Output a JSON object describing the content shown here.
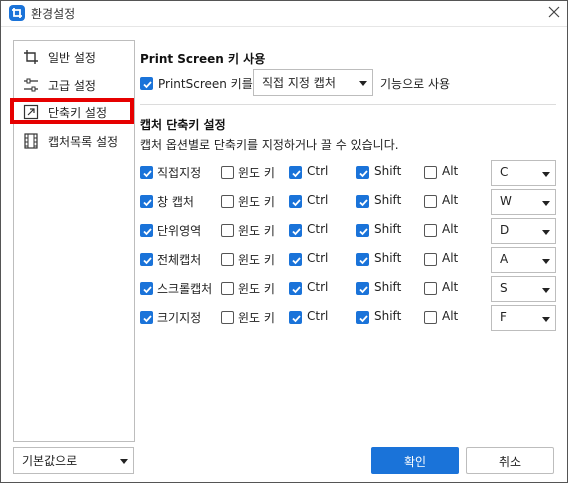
{
  "window": {
    "title": "환경설정"
  },
  "sidebar": {
    "items": [
      {
        "label": "일반 설정",
        "icon": "crop-icon"
      },
      {
        "label": "고급 설정",
        "icon": "sliders-icon"
      },
      {
        "label": "단축키 설정",
        "icon": "shortcut-icon"
      },
      {
        "label": "캡처목록 설정",
        "icon": "filmstrip-icon"
      }
    ],
    "selected": "단축키 설정"
  },
  "print_screen": {
    "section_title": "Print Screen 키 사용",
    "checkbox_label": "PrintScreen 키를",
    "checked": true,
    "select_value": "직접 지정 캡처",
    "suffix": "기능으로 사용"
  },
  "shortcut": {
    "section_title": "캡처 단축키 설정",
    "description": "캡처 옵션별로 단축키를 지정하거나 끌 수 있습니다.",
    "modifier_labels": {
      "win": "윈도 키",
      "ctrl": "Ctrl",
      "shift": "Shift",
      "alt": "Alt"
    },
    "rows": [
      {
        "name": "직접지정",
        "enabled": true,
        "win": false,
        "ctrl": true,
        "shift": true,
        "alt": false,
        "key": "C"
      },
      {
        "name": "창 캡처",
        "enabled": true,
        "win": false,
        "ctrl": true,
        "shift": true,
        "alt": false,
        "key": "W"
      },
      {
        "name": "단위영역",
        "enabled": true,
        "win": false,
        "ctrl": true,
        "shift": true,
        "alt": false,
        "key": "D"
      },
      {
        "name": "전체캡처",
        "enabled": true,
        "win": false,
        "ctrl": true,
        "shift": true,
        "alt": false,
        "key": "A"
      },
      {
        "name": "스크롤캡처",
        "enabled": true,
        "win": false,
        "ctrl": true,
        "shift": true,
        "alt": false,
        "key": "S"
      },
      {
        "name": "크기지정",
        "enabled": true,
        "win": false,
        "ctrl": true,
        "shift": true,
        "alt": false,
        "key": "F"
      }
    ]
  },
  "footer": {
    "defaults_select": "기본값으로",
    "ok_label": "확인",
    "cancel_label": "취소"
  },
  "colors": {
    "accent": "#1a73d9",
    "highlight": "#e60000"
  }
}
